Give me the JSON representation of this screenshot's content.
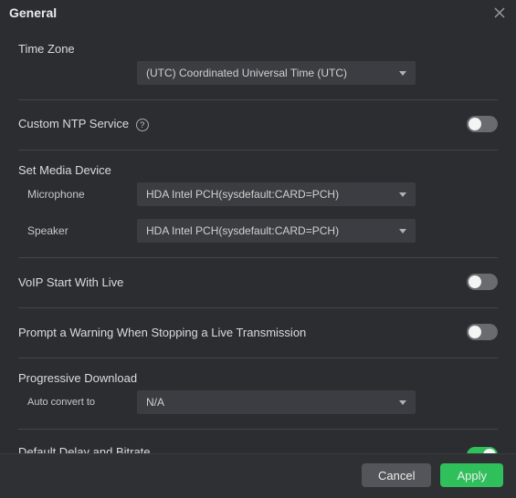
{
  "header": {
    "title": "General"
  },
  "sections": {
    "time_zone": {
      "title": "Time Zone",
      "selected": "(UTC) Coordinated Universal Time (UTC)"
    },
    "custom_ntp": {
      "title": "Custom NTP Service",
      "help_glyph": "?",
      "enabled": false
    },
    "set_media": {
      "title": "Set Media Device",
      "microphone_label": "Microphone",
      "microphone_value": "HDA Intel PCH(sysdefault:CARD=PCH)",
      "speaker_label": "Speaker",
      "speaker_value": "HDA Intel PCH(sysdefault:CARD=PCH)"
    },
    "voip": {
      "title": "VoIP Start With Live",
      "enabled": false
    },
    "prompt_warning": {
      "title": "Prompt a Warning When Stopping a Live Transmission",
      "enabled": false
    },
    "progressive_download": {
      "title": "Progressive Download",
      "auto_convert_label": "Auto convert to",
      "auto_convert_value": "N/A"
    },
    "default_delay": {
      "title": "Default Delay and Bitrate",
      "enabled": true
    }
  },
  "footer": {
    "cancel_label": "Cancel",
    "apply_label": "Apply"
  }
}
